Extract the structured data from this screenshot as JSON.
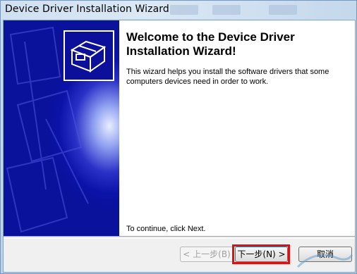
{
  "window": {
    "title": "Device Driver Installation Wizard"
  },
  "wizard": {
    "heading": "Welcome to the Device Driver Installation Wizard!",
    "description": "This wizard helps you install the software drivers that some computers devices need in order to work.",
    "continue_hint": "To continue, click Next."
  },
  "buttons": {
    "back_label": "< 上一步(B)",
    "next_label": "下一步(N) >",
    "cancel_label": "取消"
  },
  "colors": {
    "side_panel": "#0b12a8",
    "highlight": "#e01010"
  },
  "icons": {
    "wizard_graphic": "hardware-box-icon"
  }
}
